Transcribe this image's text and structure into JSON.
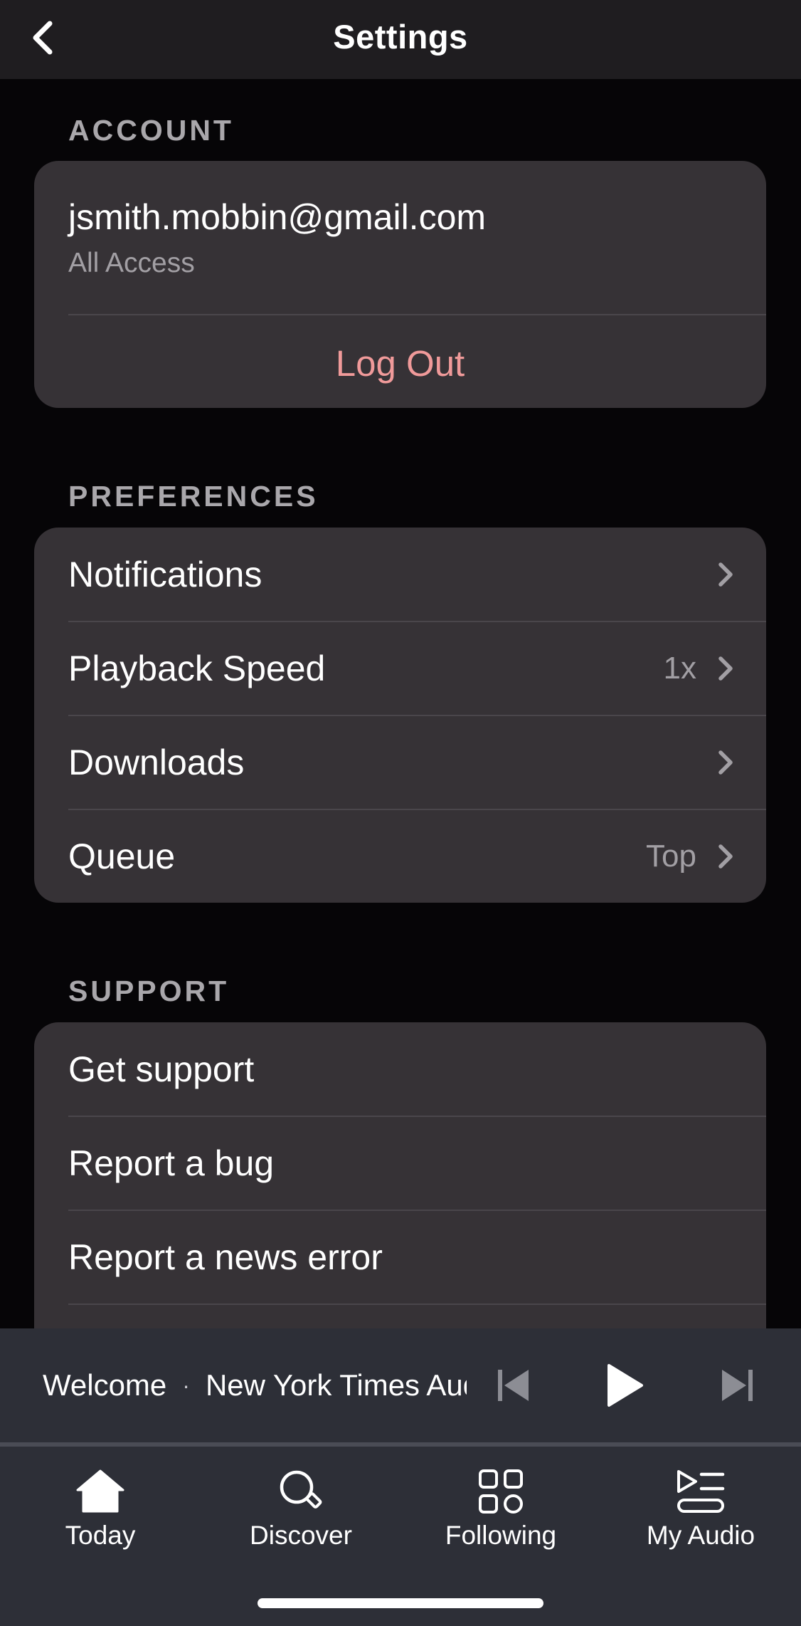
{
  "header": {
    "title": "Settings",
    "back_icon": "chevron-left-icon"
  },
  "account": {
    "section_title": "ACCOUNT",
    "email": "jsmith.mobbin@gmail.com",
    "plan": "All Access",
    "logout_label": "Log Out",
    "logout_color": "#f09a9a"
  },
  "preferences": {
    "section_title": "PREFERENCES",
    "items": [
      {
        "label": "Notifications",
        "value": ""
      },
      {
        "label": "Playback Speed",
        "value": "1x"
      },
      {
        "label": "Downloads",
        "value": ""
      },
      {
        "label": "Queue",
        "value": "Top"
      }
    ]
  },
  "support": {
    "section_title": "SUPPORT",
    "items": [
      {
        "label": "Get support"
      },
      {
        "label": "Report a bug"
      },
      {
        "label": "Report a news error"
      }
    ]
  },
  "player": {
    "title": "Welcome",
    "separator": "·",
    "source": "New York Times Audio",
    "controls": [
      "skip-back-icon",
      "play-icon",
      "skip-forward-icon"
    ]
  },
  "tabbar": {
    "items": [
      {
        "label": "Today",
        "icon": "home-icon"
      },
      {
        "label": "Discover",
        "icon": "search-icon"
      },
      {
        "label": "Following",
        "icon": "grid-icon"
      },
      {
        "label": "My Audio",
        "icon": "playlist-icon"
      }
    ]
  },
  "colors": {
    "background": "#060507",
    "card": "#363236",
    "nav": "#1f1d20",
    "player": "#2d2f37",
    "accent_red": "#f09a9a"
  }
}
